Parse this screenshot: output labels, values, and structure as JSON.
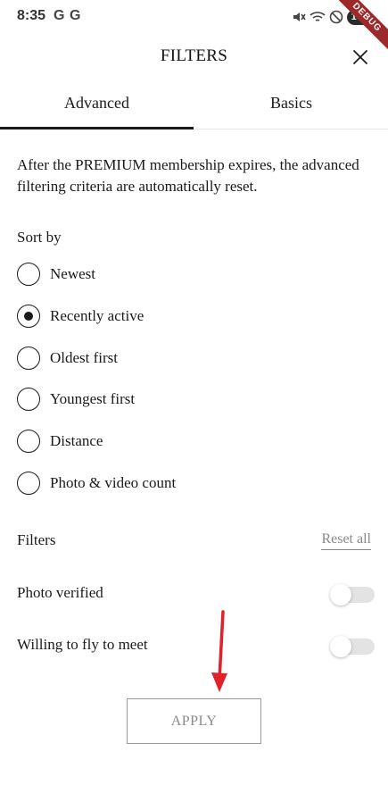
{
  "status_bar": {
    "time": "8:35",
    "app_icons": [
      "G",
      "G"
    ],
    "battery": "100",
    "debug_label": "DEBUG",
    "icons": [
      "mute-icon",
      "wifi-icon",
      "dnd-icon"
    ]
  },
  "header": {
    "title": "FILTERS",
    "close_icon": "close-icon"
  },
  "tabs": [
    {
      "label": "Advanced",
      "active": true
    },
    {
      "label": "Basics",
      "active": false
    }
  ],
  "notice": "After the PREMIUM membership expires, the advanced filtering criteria are automatically reset.",
  "sort": {
    "title": "Sort by",
    "options": [
      {
        "label": "Newest",
        "selected": false
      },
      {
        "label": "Recently active",
        "selected": true
      },
      {
        "label": "Oldest first",
        "selected": false
      },
      {
        "label": "Youngest first",
        "selected": false
      },
      {
        "label": "Distance",
        "selected": false
      },
      {
        "label": "Photo & video count",
        "selected": false
      }
    ]
  },
  "filters": {
    "title": "Filters",
    "reset_label": "Reset all",
    "toggles": [
      {
        "label": "Photo verified",
        "on": false
      },
      {
        "label": "Willing to fly to meet",
        "on": false
      }
    ]
  },
  "apply_label": "APPLY",
  "colors": {
    "annotation_arrow": "#e0202a",
    "debug_banner": "#9c2a2a",
    "tab_indicator": "#1a1a1a"
  }
}
